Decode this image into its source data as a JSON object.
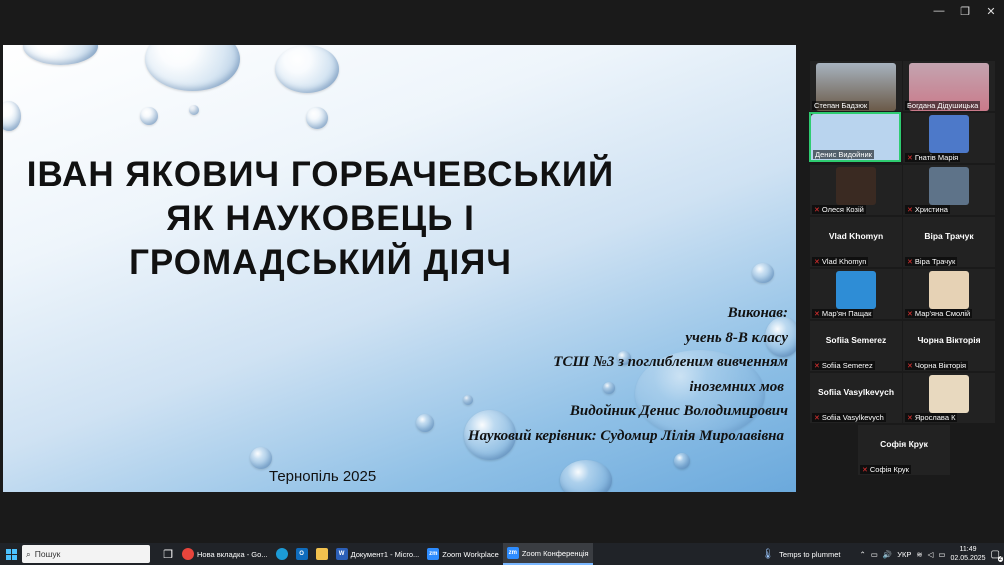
{
  "window": {
    "minimize": "—",
    "restore": "❐",
    "close": "✕"
  },
  "slide": {
    "title_lines": [
      "ІВАН ЯКОВИЧ ГОРБАЧЕВСЬКИЙ",
      "ЯК НАУКОВЕЦЬ І",
      "ГРОМАДСЬКИЙ ДІЯЧ"
    ],
    "author_lines": [
      "Виконав:",
      "учень 8-В класу",
      "ТСШ №3 з поглибленим вивченням",
      "іноземних мов",
      "Видойник Денис Володимирович",
      "Науковий керівник: Судомир Лілія Миролавівна"
    ],
    "city_year": "Тернопіль 2025"
  },
  "participants": [
    {
      "name": "Степан Бадзюк",
      "label": "",
      "avatar_color": "#6b5a48",
      "muted": false
    },
    {
      "name": "Богдана Дідушицька",
      "label": "",
      "avatar_color": "#c97a8a",
      "muted": false
    },
    {
      "name": "Денис Видойник",
      "label": "",
      "avatar_color": "#b9d4ee",
      "muted": false
    },
    {
      "name": "Гнатів Марія",
      "label": "",
      "avatar_color": "#4d79c9",
      "muted": true
    },
    {
      "name": "Олеся Козій",
      "label": "",
      "avatar_color": "#3a2a22",
      "muted": true
    },
    {
      "name": "Христина",
      "label": "",
      "avatar_color": "#5e7389",
      "muted": true
    },
    {
      "name": "Vlad Khomyn",
      "label": "Vlad Khomyn",
      "avatar_color": "",
      "muted": true
    },
    {
      "name": "Віра Трачук",
      "label": "Віра Трачук",
      "avatar_color": "",
      "muted": true
    },
    {
      "name": "Мар'ян Пащак",
      "label": "",
      "avatar_color": "#2e8dd6",
      "muted": true
    },
    {
      "name": "Мар'яна Смолій",
      "label": "",
      "avatar_color": "#e6d2b5",
      "muted": true
    },
    {
      "name": "Sofiia Semerez",
      "label": "Sofiia Semerez",
      "avatar_color": "",
      "muted": true
    },
    {
      "name": "Чорна Вікторія",
      "label": "Чорна Вікторія",
      "avatar_color": "",
      "muted": true
    },
    {
      "name": "Sofiia Vasylkevych",
      "label": "Sofiia Vasylkevych",
      "avatar_color": "",
      "muted": true
    },
    {
      "name": "Ярослава К",
      "label": "",
      "avatar_color": "#e8d9bf",
      "muted": true
    },
    {
      "name": "Софія Крук",
      "label": "Софія Крук",
      "avatar_color": "",
      "muted": true
    }
  ],
  "taskbar": {
    "search_placeholder": "Пошук",
    "apps": [
      {
        "label": "Нова вкладка - Go...",
        "icon_color": "#e8453c"
      },
      {
        "label": "Документ1 - Micro...",
        "icon_color": "#2b5fb8"
      },
      {
        "label": "Zoom Workplace",
        "icon_color": "#2d8cff"
      },
      {
        "label": "Zoom Конференція",
        "icon_color": "#2d8cff"
      }
    ],
    "weather": "Temps to plummet",
    "language": "УКР",
    "time": "11:49",
    "date": "02.05.2025",
    "notifications": "2"
  }
}
